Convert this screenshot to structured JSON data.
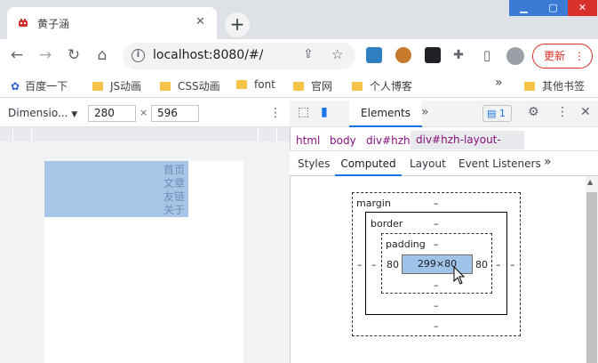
{
  "browser": {
    "tab_title": "黄子涵",
    "tab_close": "✕",
    "new_tab": "+",
    "url": "localhost:8080/#/",
    "update_label": "更新"
  },
  "bookmarks": {
    "items": [
      "百度一下",
      "JS动画",
      "CSS动画",
      "font",
      "官网",
      "个人博客"
    ],
    "overflow": "»",
    "other": "其他书签"
  },
  "device_toolbar": {
    "dimension_label": "Dimensio...",
    "width": "280",
    "height": "596",
    "times": "×"
  },
  "page": {
    "nav_items": [
      "首页",
      "文章",
      "友链",
      "关于"
    ]
  },
  "devtools": {
    "main_tab": "Elements",
    "issues_count": "1",
    "breadcrumbs": [
      "html",
      "body",
      "div#hzh",
      "div#hzh-layout-header"
    ],
    "subtabs": [
      "Styles",
      "Computed",
      "Layout",
      "Event Listeners"
    ],
    "active_subtab": "Computed",
    "box_model": {
      "margin_label": "margin",
      "margin_top": "–",
      "margin_bottom": "–",
      "margin_left": "–",
      "margin_right": "–",
      "border_label": "border",
      "border_top": "–",
      "border_bottom": "–",
      "padding_label": "padding",
      "padding_top": "–",
      "padding_bottom": "–",
      "padding_left": "80",
      "padding_right": "80",
      "content": "299×80"
    }
  },
  "colors": {
    "accent": "#1a73e8",
    "header_highlight": "#a7c5e6",
    "update_red": "#d93025"
  }
}
